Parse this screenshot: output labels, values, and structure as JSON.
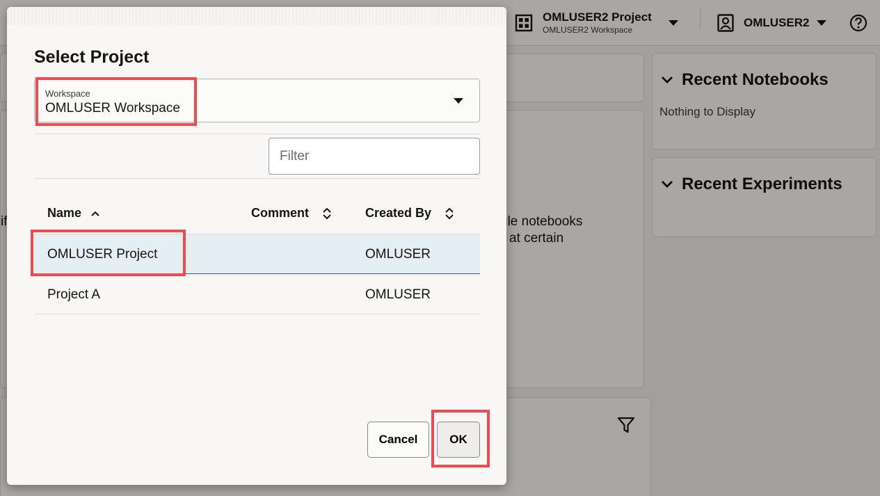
{
  "topbar": {
    "project_name": "OMLUSER2 Project",
    "workspace_name": "OMLUSER2 Workspace",
    "user_name": "OMLUSER2"
  },
  "panels": {
    "recent_notebooks": {
      "title": "Recent Notebooks",
      "empty_text": "Nothing to Display"
    },
    "recent_experiments": {
      "title": "Recent Experiments"
    }
  },
  "background_text": {
    "line1": "ule notebooks",
    "line2": "at certain",
    "left_fragment": "if"
  },
  "dialog": {
    "title": "Select Project",
    "workspace_select": {
      "label": "Workspace",
      "value": "OMLUSER Workspace"
    },
    "filter": {
      "placeholder": "Filter"
    },
    "table": {
      "columns": [
        "Name",
        "Comment",
        "Created By"
      ],
      "rows": [
        {
          "name": "OMLUSER Project",
          "comment": "",
          "created_by": "OMLUSER",
          "selected": true
        },
        {
          "name": "Project A",
          "comment": "",
          "created_by": "OMLUSER",
          "selected": false
        }
      ]
    },
    "buttons": {
      "cancel": "Cancel",
      "ok": "OK"
    }
  },
  "colors": {
    "highlight": "#ef4b4f",
    "selected_row_bg": "#e4eef3",
    "selected_row_border": "#2e6579"
  }
}
